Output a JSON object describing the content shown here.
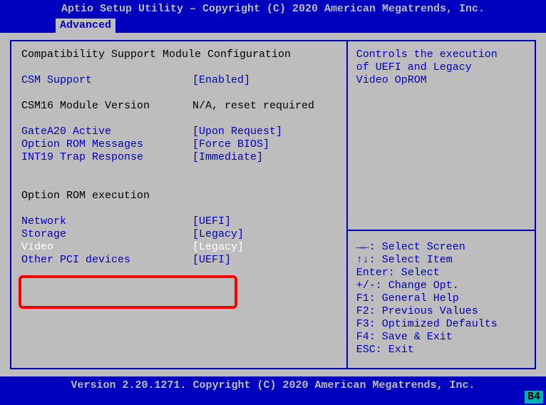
{
  "header": {
    "title": "Aptio Setup Utility – Copyright (C) 2020 American Megatrends, Inc.",
    "tab": " Advanced "
  },
  "main": {
    "section_title": "Compatibility Support Module Configuration",
    "csm_support_label": "CSM Support",
    "csm_support_value": "[Enabled]",
    "csm16_label": "CSM16 Module Version",
    "csm16_value": "N/A, reset required",
    "gatea20_label": "GateA20 Active",
    "gatea20_value": "[Upon Request]",
    "optrom_msg_label": "Option ROM Messages",
    "optrom_msg_value": "[Force BIOS]",
    "int19_label": "INT19 Trap Response",
    "int19_value": "[Immediate]",
    "optrom_exec_title": "Option ROM execution",
    "network_label": "Network",
    "network_value": "[UEFI]",
    "storage_label": "Storage",
    "storage_value": "[Legacy]",
    "video_label": "Video",
    "video_value": "[Legacy]",
    "other_pci_label": "Other PCI devices",
    "other_pci_value": "[UEFI]"
  },
  "help": {
    "line1": "Controls the execution",
    "line2": "of UEFI and Legacy",
    "line3": "Video OpROM",
    "k1": "→←: Select Screen",
    "k2": "↑↓: Select Item",
    "k3": "Enter: Select",
    "k4": "+/-: Change Opt.",
    "k5": "F1: General Help",
    "k6": "F2: Previous Values",
    "k7": "F3: Optimized Defaults",
    "k8": "F4: Save & Exit",
    "k9": "ESC: Exit"
  },
  "footer": {
    "version": "Version 2.20.1271. Copyright (C) 2020 American Megatrends, Inc.",
    "corner": "B4"
  }
}
